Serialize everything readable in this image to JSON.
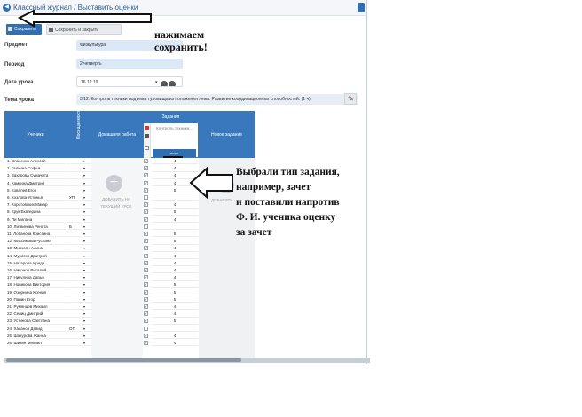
{
  "header": {
    "title": "Классный журнал / Выставить оценки"
  },
  "toolbar": {
    "save_label": "Сохранить",
    "save_close_label": "Сохранить и закрыть"
  },
  "form": {
    "subject_label": "Предмет",
    "subject_value": "Физкультура",
    "period_label": "Период",
    "period_value": "2 четверть",
    "date_label": "Дата урока",
    "date_value": "16.12.19",
    "topic_label": "Тема урока",
    "topic_value": "3.12. Контроль техники подъема туловища из положения лежа. Развитие координационных способностей. (1 ч)"
  },
  "grid": {
    "col_students": "Ученики",
    "col_presence": "Посещаемость",
    "col_homework": "Домашняя работа",
    "col_tasks": "Задания",
    "task_name": "Контроль техники...",
    "task_type": "зачет",
    "col_new_task": "Новое задание",
    "add_homework_label": "ДОБАВИТЬ НА ТЕКУЩИЙ УРОК",
    "add_task_label": "ДОБАВИТЬ",
    "rows": [
      {
        "name": "1. Власенко Алексей",
        "presence": "",
        "checked": "✓",
        "grade": "4"
      },
      {
        "name": "2. Галкина Софья",
        "presence": "",
        "checked": "✓",
        "grade": "4"
      },
      {
        "name": "3. Захарова Сумачита",
        "presence": "",
        "checked": "✓",
        "grade": "4"
      },
      {
        "name": "4. Камкина Дмитрий",
        "presence": "",
        "checked": "✓",
        "grade": "4"
      },
      {
        "name": "5. Ковалев Егор",
        "presence": "",
        "checked": "✓",
        "grade": "5"
      },
      {
        "name": "6. Козлова Устинья",
        "presence": "УП",
        "checked": "",
        "grade": ""
      },
      {
        "name": "7. Коротовских Макар",
        "presence": "",
        "checked": "✓",
        "grade": "4"
      },
      {
        "name": "8. Крук Екатерина",
        "presence": "",
        "checked": "✓",
        "grade": "5"
      },
      {
        "name": "9. Ли Милана",
        "presence": "",
        "checked": "✓",
        "grade": "4"
      },
      {
        "name": "10. Литвинова Рената",
        "presence": "Б",
        "checked": "",
        "grade": ""
      },
      {
        "name": "11. Лобанова Кристина",
        "presence": "",
        "checked": "✓",
        "grade": "5"
      },
      {
        "name": "12. Максимова Руслана",
        "presence": "",
        "checked": "✓",
        "grade": "5"
      },
      {
        "name": "13. Мирзоян Алина",
        "presence": "",
        "checked": "✓",
        "grade": "4"
      },
      {
        "name": "14. Муратов Дмитрий",
        "presence": "",
        "checked": "✓",
        "grade": "4"
      },
      {
        "name": "15. Назарова Ирида",
        "presence": "",
        "checked": "✓",
        "grade": "4"
      },
      {
        "name": "16. Никонов Виталий",
        "presence": "",
        "checked": "✓",
        "grade": "4"
      },
      {
        "name": "17. Никулина Дарья",
        "presence": "",
        "checked": "✓",
        "grade": "4"
      },
      {
        "name": "18. Новикова Виктория",
        "presence": "",
        "checked": "✓",
        "grade": "5"
      },
      {
        "name": "19. Озорнина Ксения",
        "presence": "",
        "checked": "✓",
        "grade": "5"
      },
      {
        "name": "20. Панин Егор",
        "presence": "",
        "checked": "✓",
        "grade": "5"
      },
      {
        "name": "21. Румянцев Михаил",
        "presence": "",
        "checked": "✓",
        "grade": "4"
      },
      {
        "name": "22. Селиц Дмитрий",
        "presence": "",
        "checked": "✓",
        "grade": "4"
      },
      {
        "name": "23. Устинова Светлана",
        "presence": "",
        "checked": "✓",
        "grade": "5"
      },
      {
        "name": "24. Хасанов Давид",
        "presence": "ОТ",
        "checked": "",
        "grade": ""
      },
      {
        "name": "25. Шахурова Жанна",
        "presence": "",
        "checked": "✓",
        "grade": "4"
      },
      {
        "name": "26. Шихин Михаил",
        "presence": "",
        "checked": "✓",
        "grade": "4"
      }
    ]
  },
  "annotations": {
    "save_note_line1": "нажимаем",
    "save_note_line2": "сохранить!",
    "grade_note": [
      "Выбрали тип задания,",
      "например, зачет",
      "и поставили напротив",
      "Ф. И. ученика оценку",
      "за зачет"
    ]
  },
  "colors": {
    "primary": "#2f6fb2",
    "header_blue": "#3a78bd",
    "field_bg": "#dbe9f6"
  }
}
